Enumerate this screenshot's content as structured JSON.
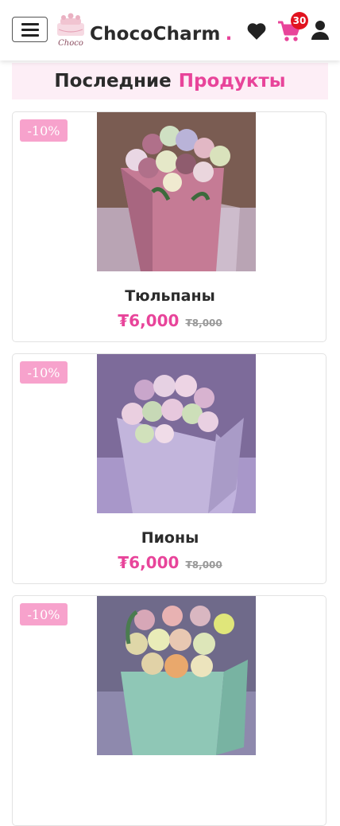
{
  "header": {
    "brand_name": "ChocoCharm",
    "brand_dot": ".",
    "logo_text": "Choco",
    "cart_count": "30",
    "colors": {
      "accent": "#e8449a",
      "badge": "#e1131f"
    }
  },
  "section": {
    "title_word1": "Последние",
    "title_word2": "Продукты"
  },
  "products": [
    {
      "discount": "-10%",
      "name": "Тюльпаны",
      "price": "₮6,000",
      "old_price": "₮8,000",
      "image": "tulips-pink-box"
    },
    {
      "discount": "-10%",
      "name": "Пионы",
      "price": "₮6,000",
      "old_price": "₮8,000",
      "image": "peonies-lilac-box"
    },
    {
      "discount": "-10%",
      "name": "",
      "price": "",
      "old_price": "",
      "image": "tulips-mint-box"
    }
  ]
}
